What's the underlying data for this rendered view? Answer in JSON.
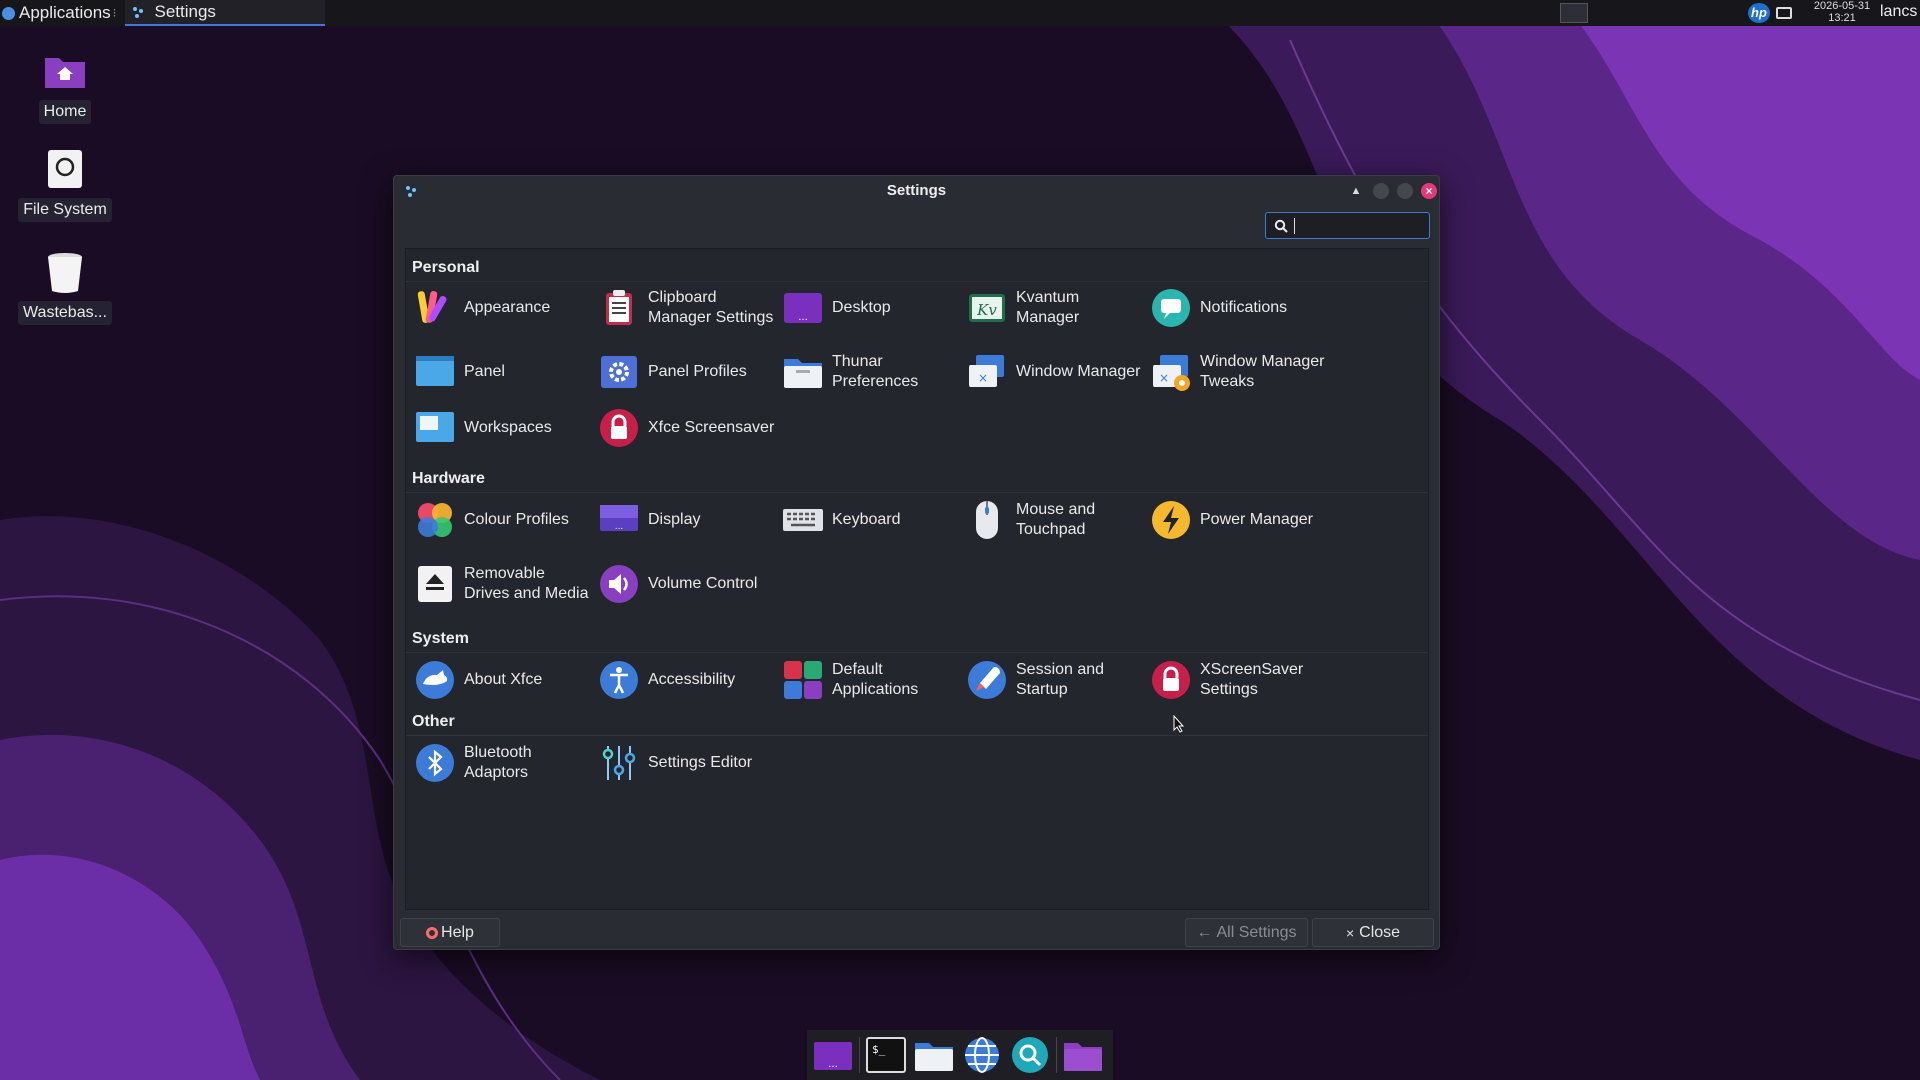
{
  "top_panel": {
    "applications_label": "Applications",
    "task_label": "Settings",
    "clock_date": "2026-05-31",
    "clock_time": "13:21",
    "user": "lancs"
  },
  "desktop_icons": [
    {
      "label": "Home",
      "icon": "home-folder-icon"
    },
    {
      "label": "File System",
      "icon": "drive-icon"
    },
    {
      "label": "Wastebas...",
      "icon": "trash-icon"
    }
  ],
  "window": {
    "title": "Settings",
    "search_value": "",
    "sections": [
      {
        "title": "Personal"
      },
      {
        "title": "Hardware"
      },
      {
        "title": "System"
      },
      {
        "title": "Other"
      }
    ],
    "items": {
      "appearance": "Appearance",
      "clipboard": "Clipboard Manager Settings",
      "desktop": "Desktop",
      "kvantum": "Kvantum Manager",
      "notifications": "Notifications",
      "panel": "Panel",
      "panel_profiles": "Panel Profiles",
      "thunar": "Thunar Preferences",
      "window_manager": "Window Manager",
      "wm_tweaks": "Window Manager Tweaks",
      "workspaces": "Workspaces",
      "xfce_screensaver": "Xfce Screensaver",
      "colour_profiles": "Colour Profiles",
      "display": "Display",
      "keyboard": "Keyboard",
      "mouse": "Mouse and Touchpad",
      "power": "Power Manager",
      "removable": "Removable Drives and Media",
      "volume": "Volume Control",
      "about": "About Xfce",
      "accessibility": "Accessibility",
      "default_apps": "Default Applications",
      "session": "Session and Startup",
      "xscreensaver": "XScreenSaver Settings",
      "bluetooth": "Bluetooth Adaptors",
      "settings_editor": "Settings Editor"
    },
    "buttons": {
      "help": "Help",
      "all_settings": "All Settings",
      "close": "Close"
    }
  },
  "colors": {
    "accent": "#3d7bd9",
    "close_button": "#e5387a",
    "purple": "#7b2fbf"
  }
}
